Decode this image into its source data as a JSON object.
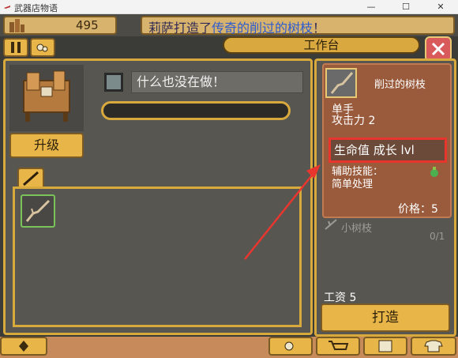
{
  "window": {
    "title": "武器店物语"
  },
  "topbar": {
    "money": "495",
    "message_prefix": "莉萨打造了",
    "message_highlight": "传奇的削过的树枝",
    "message_suffix": "！"
  },
  "workbench": {
    "title": "工作台",
    "upgrade_label": "升级",
    "status_text": "什么也没在做！"
  },
  "card": {
    "name": "削过的树枝",
    "hand": "单手",
    "attack": "攻击力 2",
    "growth": "生命值 成长 lvl",
    "sub_skill_label": "辅助技能：",
    "sub_skill_value": "简单处理",
    "price": "价格：5"
  },
  "material": {
    "name": "小树枝",
    "count": "0/1"
  },
  "wage": "工资 5",
  "craft_label": "打造",
  "colors": {
    "highlight_box": "#e8362f",
    "arrow": "#e8362f"
  }
}
